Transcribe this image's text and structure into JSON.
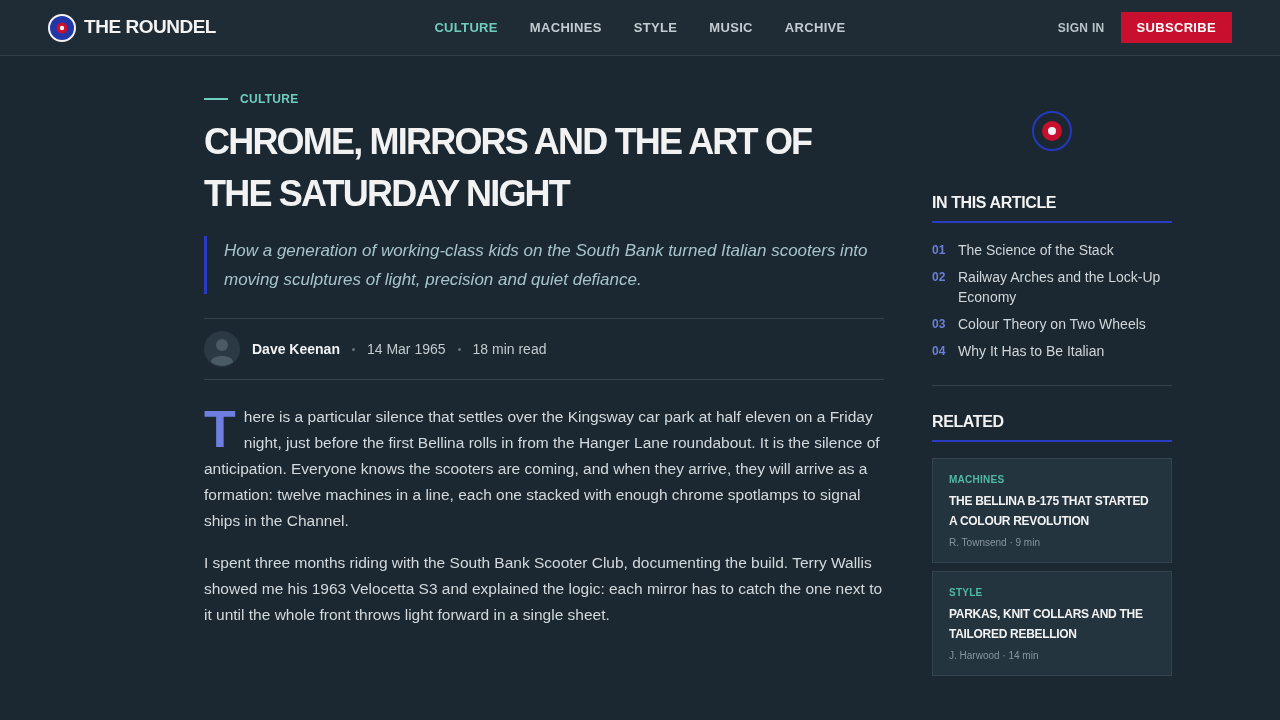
{
  "header": {
    "logo": "THE ROUNDEL",
    "nav": [
      {
        "label": "CULTURE",
        "selected": true
      },
      {
        "label": "MACHINES",
        "selected": false
      },
      {
        "label": "STYLE",
        "selected": false
      },
      {
        "label": "MUSIC",
        "selected": false
      },
      {
        "label": "ARCHIVE",
        "selected": false
      }
    ],
    "sign_in": "SIGN IN",
    "subscribe": "SUBSCRIBE"
  },
  "article": {
    "category": "CULTURE",
    "title": "CHROME, MIRRORS AND THE ART OF THE SATURDAY NIGHT",
    "standfirst": "How a generation of working-class kids on the South Bank turned Italian scooters into moving sculptures of light, precision and quiet defiance.",
    "byline": {
      "author": "Dave Keenan",
      "date": "14 Mar 1965",
      "read_time": "18 min read"
    },
    "paragraphs": [
      {
        "drop_cap": true,
        "text": "There is a particular silence that settles over the Kingsway car park at half eleven on a Friday night, just before the first Bellina rolls in from the Hanger Lane roundabout. It is the silence of anticipation. Everyone knows the scooters are coming, and when they arrive, they will arrive as a formation: twelve machines in a line, each one stacked with enough chrome spotlamps to signal ships in the Channel."
      },
      {
        "drop_cap": false,
        "text": "I spent three months riding with the South Bank Scooter Club, documenting the build. Terry Wallis showed me his 1963 Velocetta S3 and explained the logic: each mirror has to catch the one next to it until the whole front throws light forward in a single sheet."
      }
    ]
  },
  "sidebar": {
    "contents": {
      "heading": "IN THIS ARTICLE",
      "items": [
        {
          "number": "01",
          "title": "The Science of the Stack"
        },
        {
          "number": "02",
          "title": "Railway Arches and the Lock-Up Economy"
        },
        {
          "number": "03",
          "title": "Colour Theory on Two Wheels"
        },
        {
          "number": "04",
          "title": "Why It Has to Be Italian"
        }
      ]
    },
    "related": {
      "heading": "RELATED",
      "cards": [
        {
          "category": "MACHINES",
          "title": "THE BELLINA B-175 THAT STARTED A COLOUR REVOLUTION",
          "meta": "R. Townsend · 9 min"
        },
        {
          "category": "STYLE",
          "title": "PARKAS, KNIT COLLARS AND THE TAILORED REBELLION",
          "meta": "J. Harwood · 14 min"
        }
      ]
    }
  }
}
